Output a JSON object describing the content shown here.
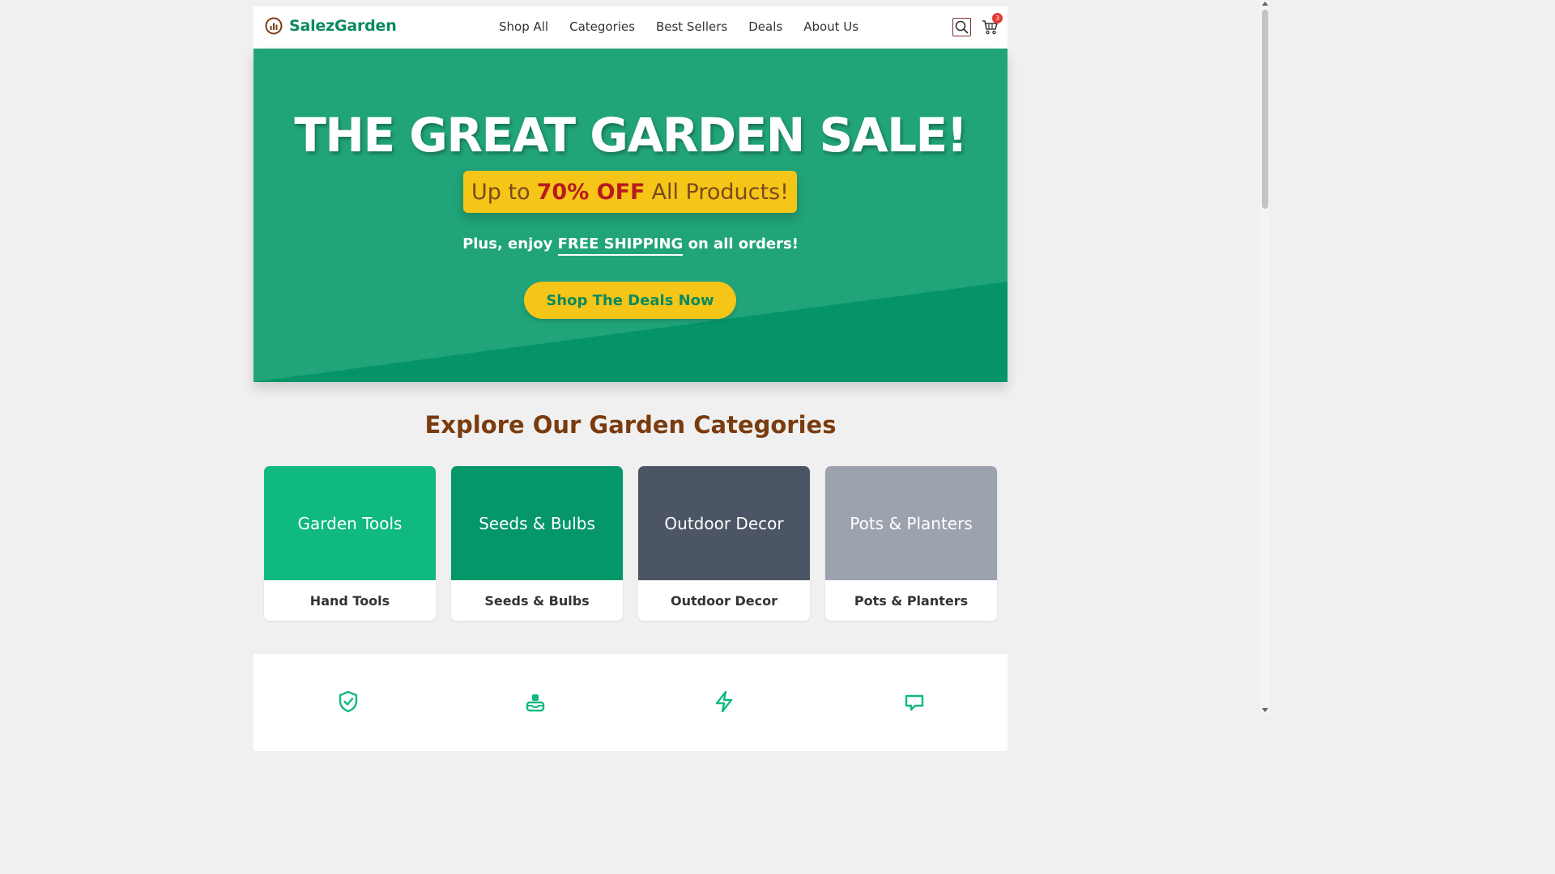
{
  "brand": {
    "name": "SalezGarden",
    "color": "#0c8a5e",
    "icon": "bar-chart-circle-icon"
  },
  "nav": {
    "items": [
      {
        "label": "Shop All"
      },
      {
        "label": "Categories"
      },
      {
        "label": "Best Sellers"
      },
      {
        "label": "Deals"
      },
      {
        "label": "About Us"
      }
    ]
  },
  "header_icons": {
    "search": "search-icon",
    "cart": "cart-icon",
    "cart_count": "3"
  },
  "hero": {
    "title": "THE GREAT GARDEN SALE!",
    "promo_prefix": "Up to",
    "promo_highlight": "70% OFF",
    "promo_suffix": "All Products!",
    "sub_prefix": "Plus, enjoy",
    "sub_highlight": "FREE SHIPPING",
    "sub_suffix": "on all orders!",
    "cta_label": "Shop The Deals Now",
    "bg_color": "#21a47a",
    "accent_color": "#f5c518"
  },
  "categories": {
    "title": "Explore Our Garden Categories",
    "items": [
      {
        "image_text": "Garden Tools",
        "label": "Hand Tools",
        "color": "#10b981"
      },
      {
        "image_text": "Seeds & Bulbs",
        "label": "Seeds & Bulbs",
        "color": "#059669"
      },
      {
        "image_text": "Outdoor Decor",
        "label": "Outdoor Decor",
        "color": "#4b5563"
      },
      {
        "image_text": "Pots & Planters",
        "label": "Pots & Planters",
        "color": "#9ca3af"
      }
    ]
  },
  "features": {
    "icons": [
      "shield-check-icon",
      "inbox-download-icon",
      "lightning-icon",
      "chat-bubble-icon"
    ]
  }
}
